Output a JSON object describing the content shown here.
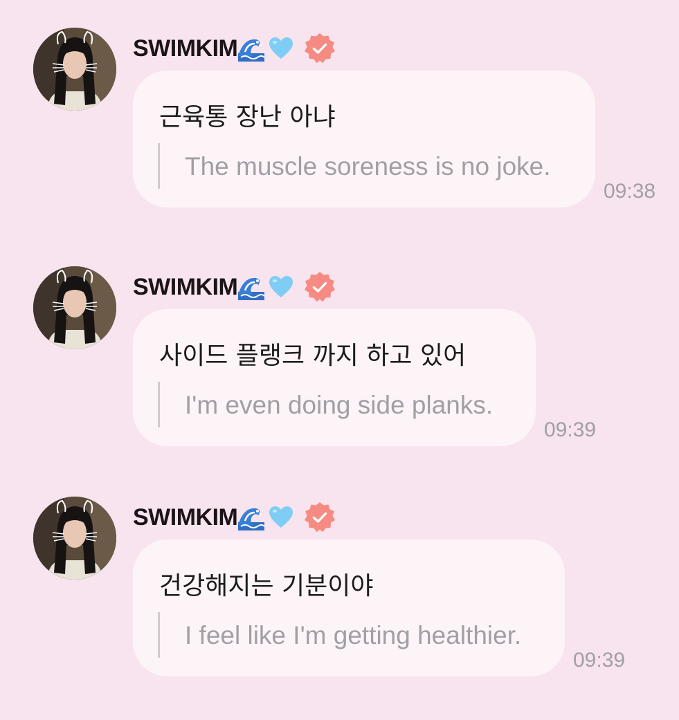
{
  "theme": {
    "background": "#f8e4ee",
    "bubble": "#fdf4f8",
    "verified_badge": "#f58b82",
    "heart": "#7fcdf5"
  },
  "messages": [
    {
      "sender": "SWIMKIM",
      "sender_icons": [
        "wave-emoji-icon",
        "light-blue-heart-icon",
        "verified-badge-icon"
      ],
      "text": "근육통 장난 아냐",
      "translation": "The muscle soreness is no joke.",
      "time": "09:38"
    },
    {
      "sender": "SWIMKIM",
      "sender_icons": [
        "wave-emoji-icon",
        "light-blue-heart-icon",
        "verified-badge-icon"
      ],
      "text": "사이드 플랭크 까지 하고 있어",
      "translation": "I'm even doing side planks.",
      "time": "09:39"
    },
    {
      "sender": "SWIMKIM",
      "sender_icons": [
        "wave-emoji-icon",
        "light-blue-heart-icon",
        "verified-badge-icon"
      ],
      "text": "건강해지는 기분이야",
      "translation": "I feel like I'm getting healthier.",
      "time": "09:39"
    }
  ]
}
